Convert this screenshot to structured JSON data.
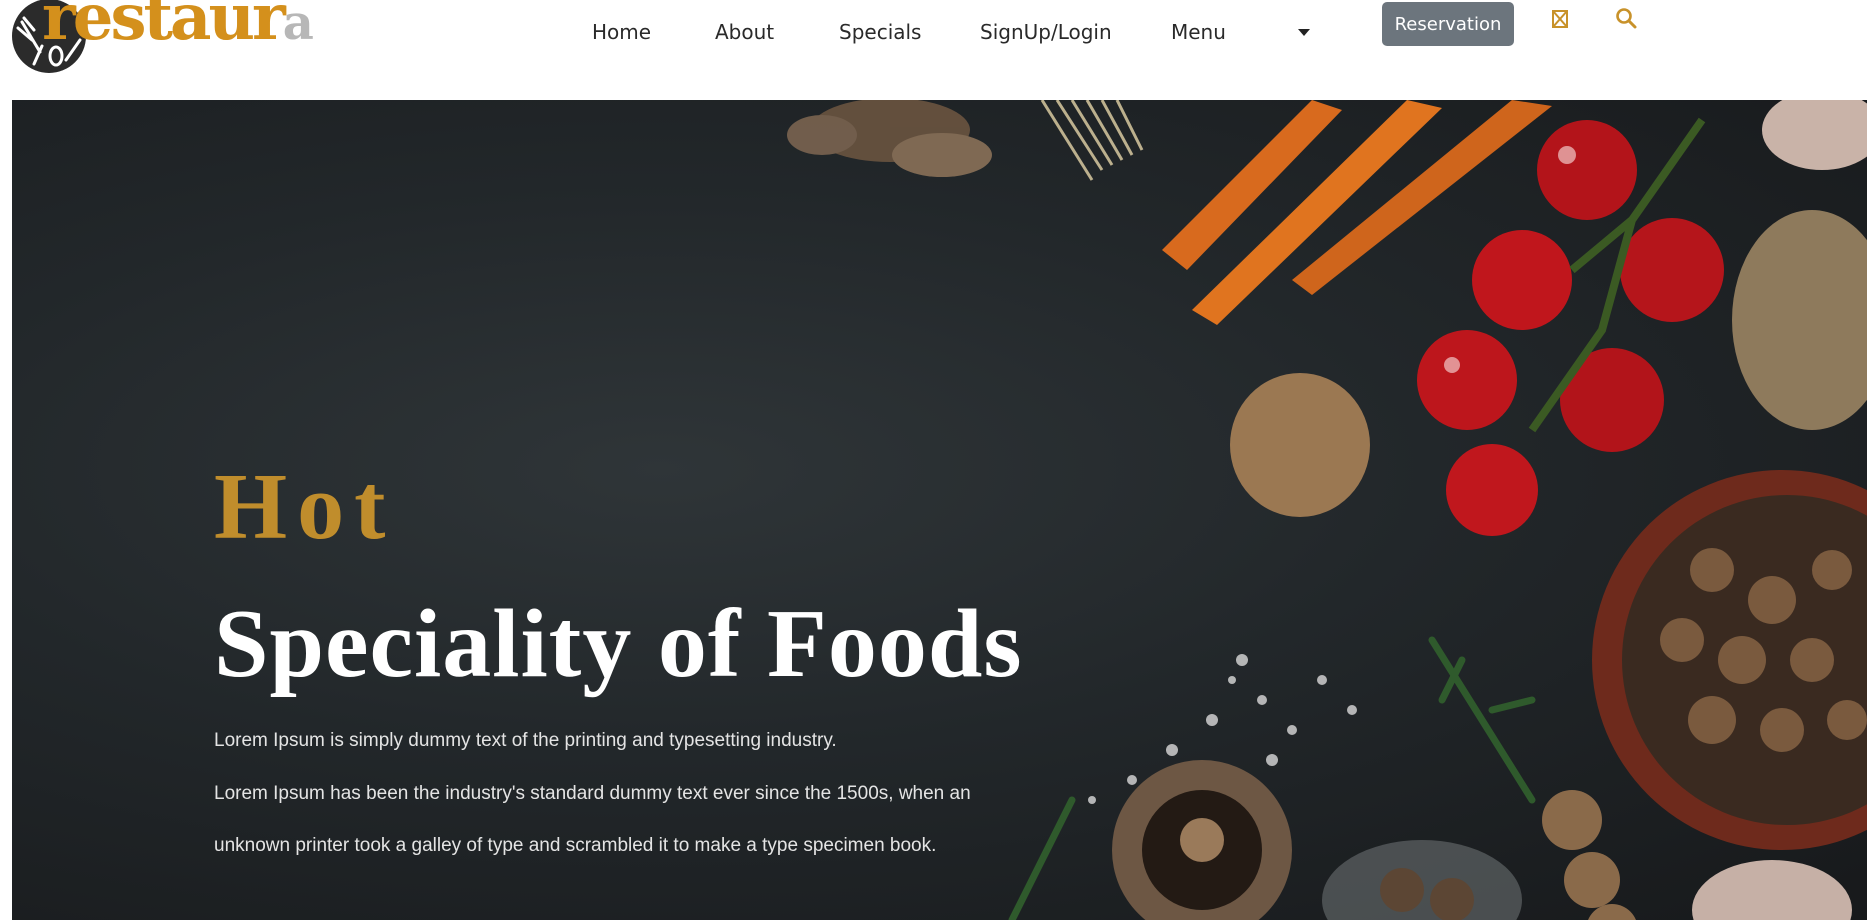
{
  "brand": {
    "logo_main": "restaur",
    "logo_tail": "a",
    "gold": "#d4901c"
  },
  "nav": {
    "items": [
      {
        "label": "Home"
      },
      {
        "label": "About"
      },
      {
        "label": "Specials"
      },
      {
        "label": "SignUp/Login"
      },
      {
        "label": "Menu"
      }
    ],
    "dropdown_icon": "caret-down-icon",
    "reservation_label": "Reservation",
    "cart_icon": "shopping-bag-icon",
    "search_icon": "search-icon"
  },
  "hero": {
    "subtitle": "Hot",
    "title": "Speciality of Foods",
    "paragraphs": [
      "Lorem Ipsum is simply dummy text of the printing and typesetting industry.",
      "Lorem Ipsum has been the industry's standard dummy text ever since the 1500s, when an",
      "unknown printer took a galley of type and scrambled it to make a type specimen book."
    ],
    "colors": {
      "subtitle": "#c08d2c",
      "title": "#ffffff",
      "background": "#22272a"
    }
  }
}
